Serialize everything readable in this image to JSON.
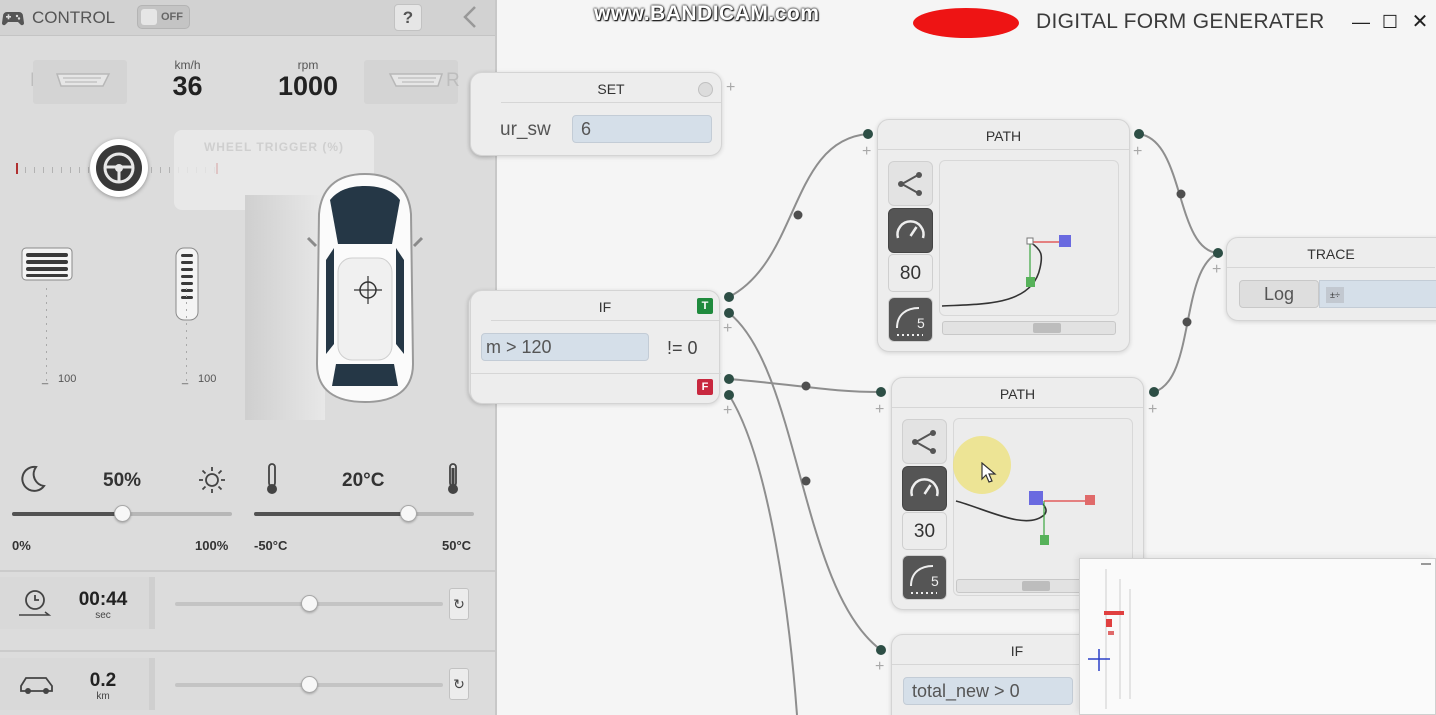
{
  "panel": {
    "title": "CONTROL",
    "toggle_label": "OFF",
    "help_label": "?",
    "lamp_left_label": "L",
    "lamp_right_label": "R",
    "speed": {
      "unit": "km/h",
      "value": "36"
    },
    "rpm": {
      "unit": "rpm",
      "value": "1000"
    },
    "wheel_trigger_label": "WHEEL TRIGGER (%)",
    "pedal_left_max": "100",
    "pedal_right_max": "100",
    "brightness": {
      "value": "50%",
      "min": "0%",
      "max": "100%",
      "level": 0.5
    },
    "temperature": {
      "value": "20°C",
      "min": "-50°C",
      "max": "50°C",
      "level": 0.7
    },
    "timer": {
      "value": "00:44",
      "unit": "sec",
      "level": 0.5
    },
    "distance": {
      "value": "0.2",
      "unit": "km",
      "level": 0.5
    }
  },
  "window": {
    "watermark": "www.BANDICAM.com",
    "title": "DIGITAL FORM GENERATER",
    "minimize": "✕",
    "controls": [
      "—",
      "☐",
      "✕"
    ]
  },
  "nodes": {
    "set": {
      "title": "SET",
      "var": "ur_sw",
      "value": "6"
    },
    "if1": {
      "title": "IF",
      "condition": "m > 120",
      "op": "!= 0",
      "true_flag": "T",
      "false_flag": "F"
    },
    "path1": {
      "title": "PATH",
      "speed": "80",
      "curve": "5"
    },
    "path2": {
      "title": "PATH",
      "speed": "30",
      "curve": "5"
    },
    "trace": {
      "title": "TRACE",
      "mode": "Log"
    },
    "if2": {
      "title": "IF",
      "condition": "total_new > 0"
    }
  },
  "colors": {
    "accent": "#2d4e45",
    "true_flag": "#1f8a3d",
    "false_flag": "#c8283f",
    "field": "#d5dfe9"
  }
}
